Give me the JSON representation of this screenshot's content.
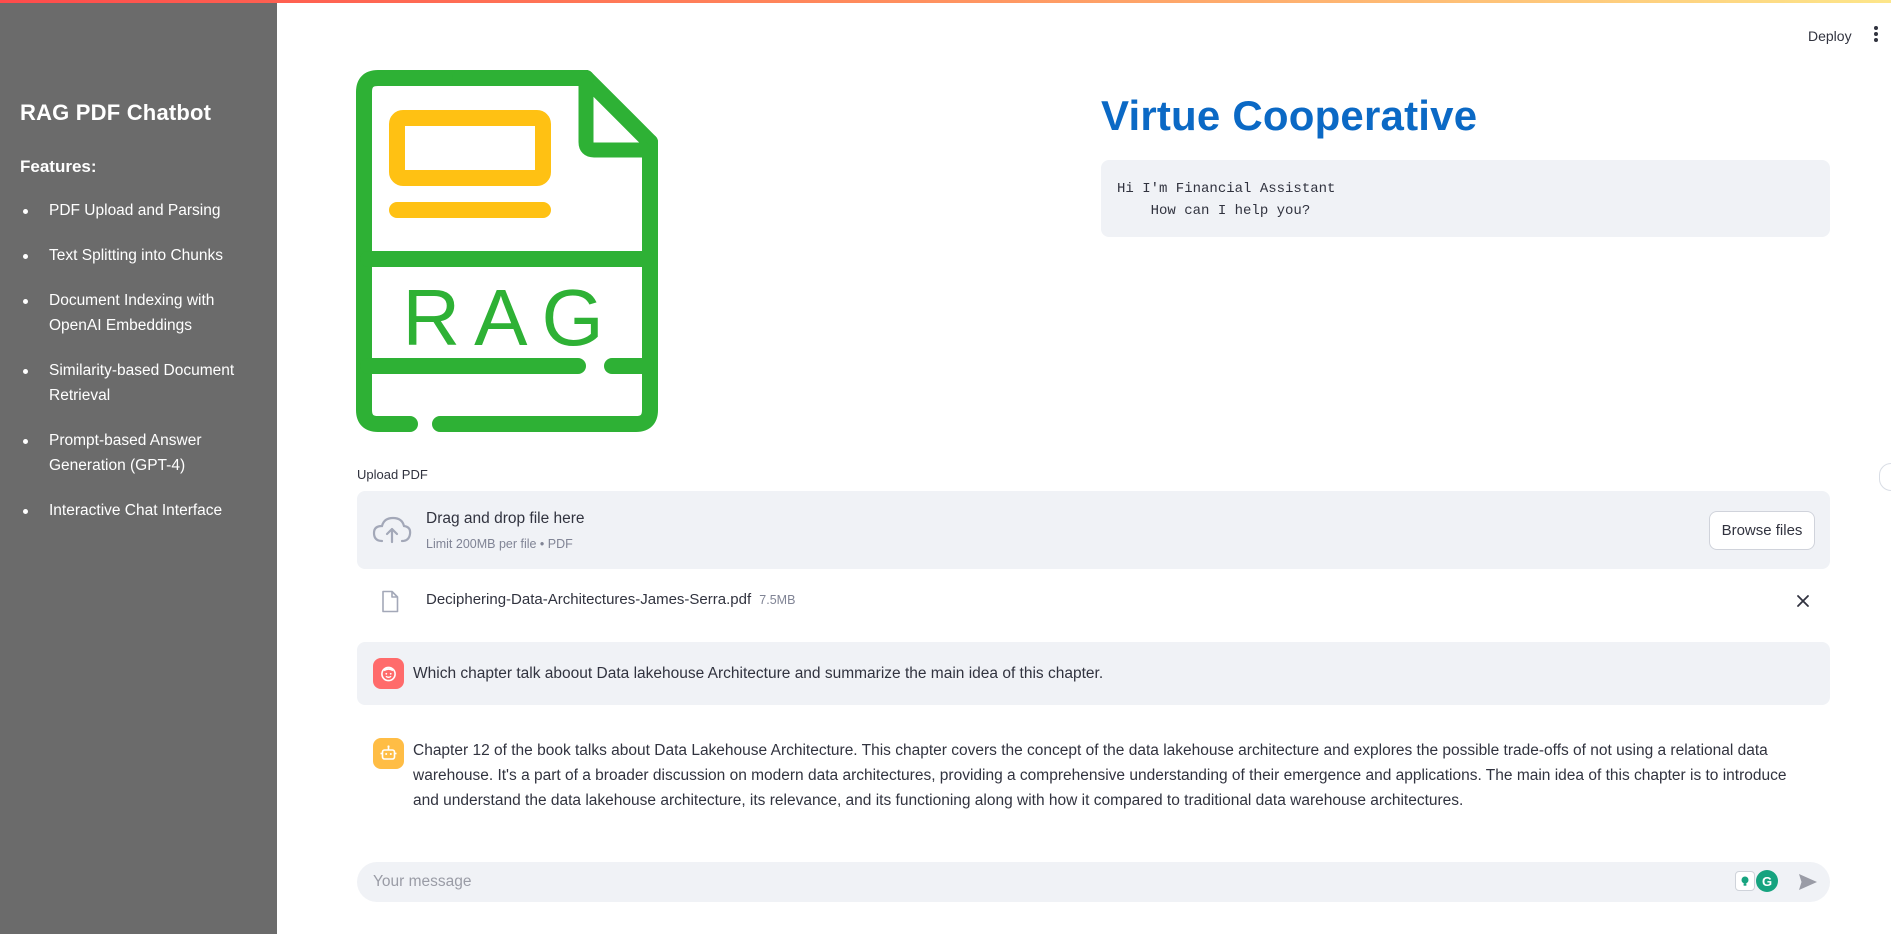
{
  "sidebar": {
    "title": "RAG PDF Chatbot",
    "features_heading": "Features:",
    "items": [
      {
        "label": "PDF Upload and Parsing"
      },
      {
        "label": "Text Splitting into Chunks"
      },
      {
        "label": "Document Indexing with OpenAI Embeddings"
      },
      {
        "label": "Similarity-based Document Retrieval"
      },
      {
        "label": "Prompt-based Answer Generation (GPT-4)"
      },
      {
        "label": "Interactive Chat Interface"
      }
    ]
  },
  "header": {
    "deploy_label": "Deploy"
  },
  "logo": {
    "text": "RAG",
    "colors": {
      "frame": "#2eb135",
      "accent": "#ffc113"
    }
  },
  "main": {
    "title": "Virtue Cooperative",
    "greeting": "Hi I'm Financial Assistant\n    How can I help you?"
  },
  "upload": {
    "label": "Upload PDF",
    "dropzone_text": "Drag and drop file here",
    "limit_text": "Limit 200MB per file • PDF",
    "browse_label": "Browse files",
    "file": {
      "name": "Deciphering-Data-Architectures-James-Serra.pdf",
      "size": "7.5MB"
    }
  },
  "messages": [
    {
      "role": "user",
      "text": "Which chapter talk aboout Data lakehouse Architecture and summarize the main idea of this chapter."
    },
    {
      "role": "assistant",
      "text": "Chapter 12 of the book talks about Data Lakehouse Architecture. This chapter covers the concept of the data lakehouse architecture and explores the possible trade-offs of not using a relational data warehouse. It's a part of a broader discussion on modern data architectures, providing a comprehensive understanding of their emergence and applications. The main idea of this chapter is to introduce and understand the data lakehouse architecture, its relevance, and its functioning along with how it compared to traditional data warehouse architectures."
    }
  ],
  "chat_input": {
    "placeholder": "Your message"
  },
  "colors": {
    "sidebar_bg": "#6b6b6b",
    "title": "#0b69c5",
    "panel_bg": "#f0f2f6",
    "user_avatar": "#ff6b6b",
    "bot_avatar": "#ffbd45"
  }
}
